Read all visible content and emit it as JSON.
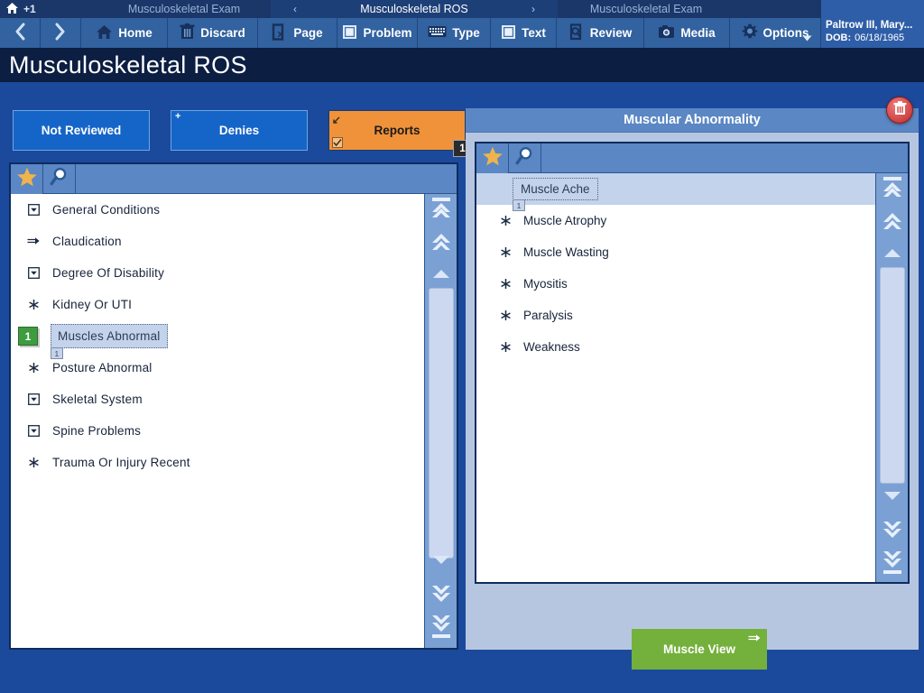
{
  "crumbbar": {
    "home_badge": "+1",
    "prev_label": "Musculoskeletal Exam",
    "left_arrow": "‹",
    "current_label": "Musculoskeletal ROS",
    "right_arrow": "›",
    "next_label": "Musculoskeletal Exam"
  },
  "patient": {
    "name": "Paltrow III, Mary...",
    "dob_label": "DOB:",
    "dob_value": "06/18/1965"
  },
  "toolbar": {
    "back_icon": "chevron-left-icon",
    "forward_icon": "chevron-right-icon",
    "buttons": [
      {
        "label": "Home",
        "icon": "home-icon"
      },
      {
        "label": "Discard",
        "icon": "trash-icon"
      },
      {
        "label": "Page",
        "icon": "page-x-icon"
      },
      {
        "label": "Problem",
        "icon": "window-icon"
      },
      {
        "label": "Type",
        "icon": "keyboard-icon"
      },
      {
        "label": "Text",
        "icon": "document-icon"
      },
      {
        "label": "Review",
        "icon": "magnifier-document-icon"
      },
      {
        "label": "Media",
        "icon": "camera-icon"
      },
      {
        "label": "Options",
        "icon": "gear-icon"
      }
    ]
  },
  "page": {
    "title": "Musculoskeletal ROS"
  },
  "tabs": [
    {
      "label": "Not Reviewed",
      "state": "inactive",
      "corner": "none",
      "count": ""
    },
    {
      "label": "Denies",
      "state": "inactive",
      "corner": "plus",
      "count": ""
    },
    {
      "label": "Reports",
      "state": "active",
      "corner": "check",
      "count": "1"
    }
  ],
  "left_panel": {
    "tools": [
      {
        "name": "favorites-star-icon"
      },
      {
        "name": "search-magnifier-icon"
      }
    ],
    "items": [
      {
        "label": "General Conditions",
        "marker": "dropdown-box",
        "selected": false
      },
      {
        "label": "Claudication",
        "marker": "double-arrow",
        "selected": false
      },
      {
        "label": "Degree Of Disability",
        "marker": "dropdown-box",
        "selected": false
      },
      {
        "label": "Kidney  Or UTI",
        "marker": "asterisk",
        "selected": false
      },
      {
        "label": "Muscles Abnormal",
        "marker": "badge",
        "selected": true,
        "badge": "1",
        "sub_badge": "1"
      },
      {
        "label": "Posture Abnormal",
        "marker": "asterisk",
        "selected": false
      },
      {
        "label": "Skeletal System",
        "marker": "dropdown-box",
        "selected": false
      },
      {
        "label": "Spine Problems",
        "marker": "dropdown-box",
        "selected": false
      },
      {
        "label": "Trauma Or Injury Recent",
        "marker": "asterisk",
        "selected": false
      }
    ]
  },
  "right_panel": {
    "header": "Muscular Abnormality",
    "delete_icon": "trash-icon",
    "tools": [
      {
        "name": "favorites-star-icon"
      },
      {
        "name": "search-magnifier-icon"
      }
    ],
    "items": [
      {
        "label": "Muscle Ache",
        "marker": "none",
        "selected": true,
        "sub_badge": "1"
      },
      {
        "label": "Muscle Atrophy",
        "marker": "asterisk",
        "selected": false
      },
      {
        "label": "Muscle Wasting",
        "marker": "asterisk",
        "selected": false
      },
      {
        "label": "Myositis",
        "marker": "asterisk",
        "selected": false
      },
      {
        "label": "Paralysis",
        "marker": "asterisk",
        "selected": false
      },
      {
        "label": "Weakness",
        "marker": "asterisk",
        "selected": false
      }
    ],
    "action_button": {
      "label": "Muscle View",
      "icon": "double-arrow-icon"
    }
  },
  "colors": {
    "window_bg": "#1b4a9c",
    "crumb_bg": "#1b3668",
    "toolbar_bg": "#32629f",
    "title_bg": "#0c1e42",
    "tab_inactive": "#1565c8",
    "tab_active": "#f0923a",
    "panel_header": "#5b87c4",
    "list_bg": "#ffffff",
    "selection": "#c3d3ec",
    "scroll_track": "#7ba0d4",
    "scroll_thumb": "#ccd8ef",
    "green_button": "#74b03c",
    "green_badge": "#3f9b3f",
    "delete_red": "#c02a2a"
  }
}
